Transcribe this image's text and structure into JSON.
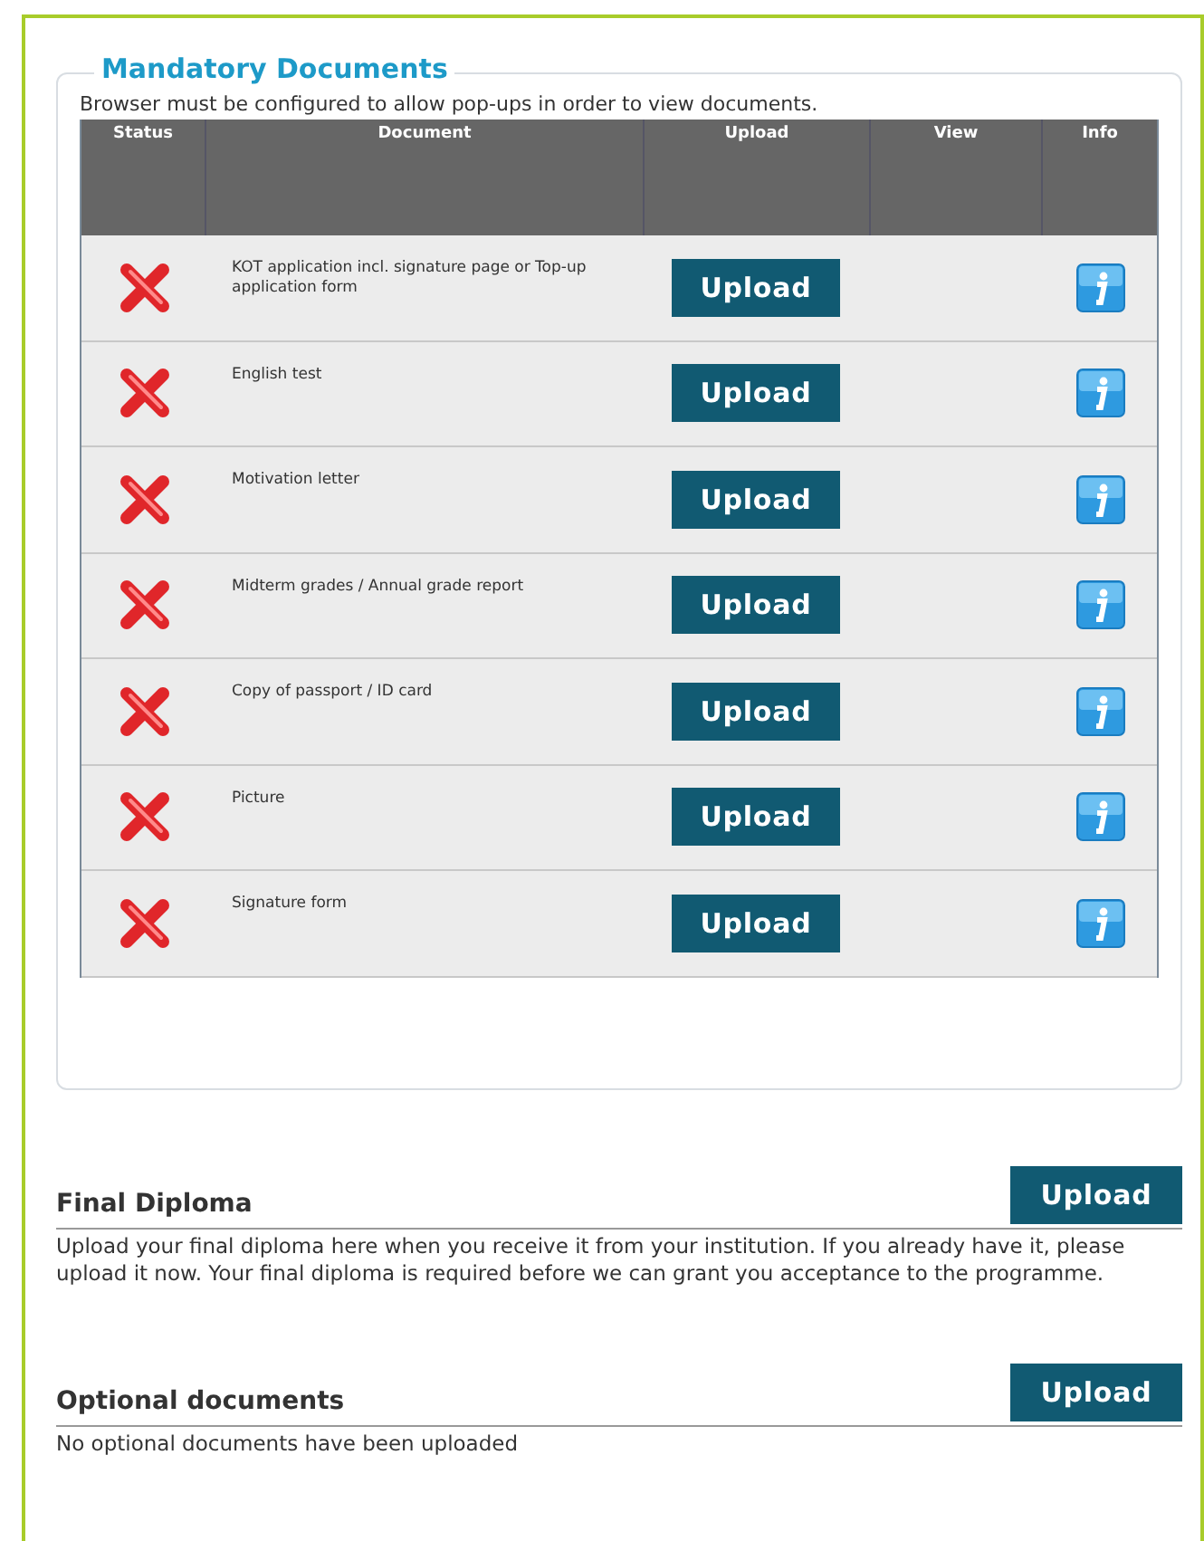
{
  "mandatory": {
    "title": "Mandatory Documents",
    "note": "Browser must be configured to allow pop-ups in order to view documents.",
    "columns": [
      "Status",
      "Document",
      "Upload",
      "View",
      "Info"
    ],
    "rows": [
      {
        "uploaded": false,
        "document": "KOT application incl. signature page or Top-up application form",
        "button": "Upload"
      },
      {
        "uploaded": false,
        "document": "English test",
        "button": "Upload"
      },
      {
        "uploaded": false,
        "document": "Motivation letter",
        "button": "Upload"
      },
      {
        "uploaded": false,
        "document": "Midterm grades / Annual grade report",
        "button": "Upload"
      },
      {
        "uploaded": false,
        "document": "Copy of passport / ID card",
        "button": "Upload"
      },
      {
        "uploaded": false,
        "document": "Picture",
        "button": "Upload"
      },
      {
        "uploaded": false,
        "document": "Signature form",
        "button": "Upload"
      }
    ]
  },
  "sections": [
    {
      "title": "Final Diploma",
      "button": "Upload",
      "text": "Upload your final diploma here when you receive it from your institution. If you already have it, please upload it now. Your final diploma is required before we can grant you acceptance to the programme."
    },
    {
      "title": "Optional documents",
      "button": "Upload",
      "text": "No optional documents have been uploaded"
    }
  ]
}
